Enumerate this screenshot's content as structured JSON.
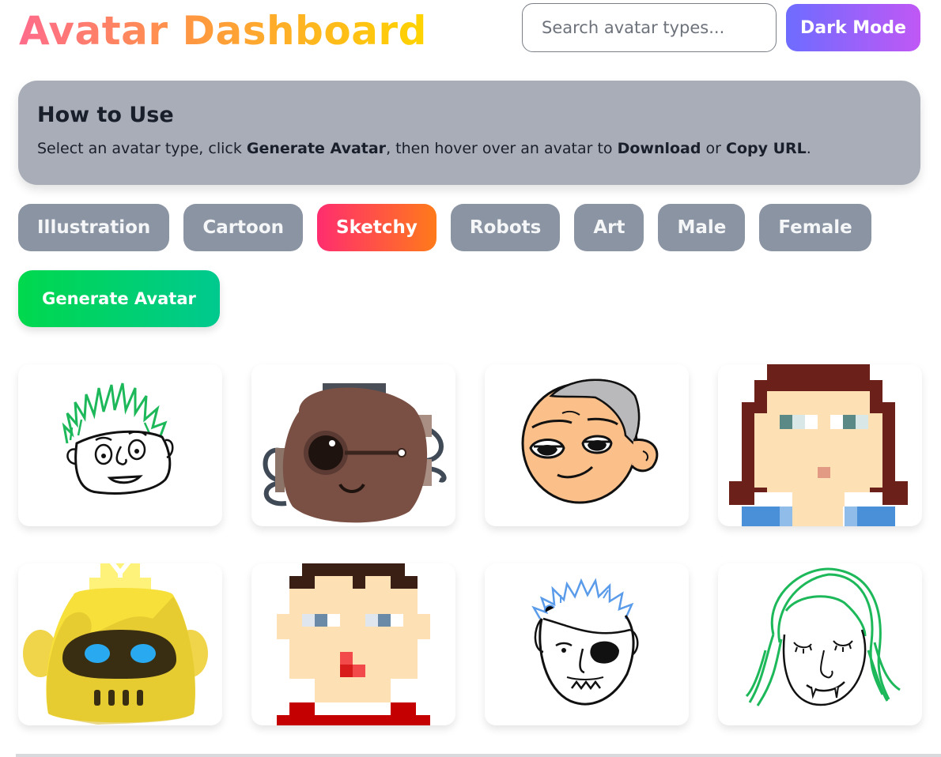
{
  "header": {
    "title": "Avatar Dashboard",
    "search_placeholder": "Search avatar types...",
    "dark_mode_label": "Dark Mode"
  },
  "how_to": {
    "heading": "How to Use",
    "text_1": "Select an avatar type, click ",
    "bold_1": "Generate Avatar",
    "text_2": ", then hover over an avatar to ",
    "bold_2": "Download",
    "text_3": " or ",
    "bold_3": "Copy URL",
    "text_4": "."
  },
  "filters": [
    {
      "label": "Illustration",
      "active": false
    },
    {
      "label": "Cartoon",
      "active": false
    },
    {
      "label": "Sketchy",
      "active": true
    },
    {
      "label": "Robots",
      "active": false
    },
    {
      "label": "Art",
      "active": false
    },
    {
      "label": "Male",
      "active": false
    },
    {
      "label": "Female",
      "active": false
    }
  ],
  "generate_label": "Generate Avatar",
  "avatars": [
    {
      "type": "sketchy-green-hair"
    },
    {
      "type": "brown-robot-eyepatch"
    },
    {
      "type": "cartoon-old-man"
    },
    {
      "type": "pixel-woman-brown-hair"
    },
    {
      "type": "yellow-robot"
    },
    {
      "type": "pixel-man-dark-hair"
    },
    {
      "type": "sketchy-eyepatch-man"
    },
    {
      "type": "sketchy-green-hair-woman"
    }
  ],
  "colors": {
    "accent_active": "#ff2d6f",
    "chip_inactive": "#8b94a2",
    "generate": "#00d84d",
    "dark_mode": "#6e6cff"
  }
}
